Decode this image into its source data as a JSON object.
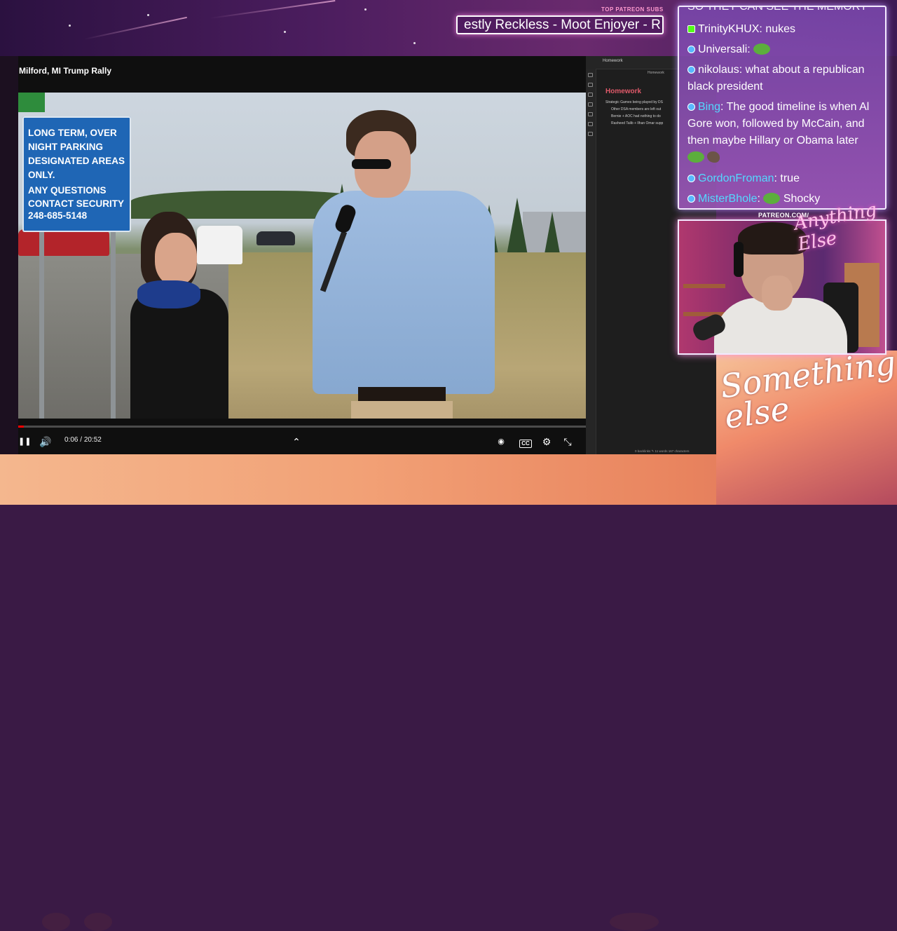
{
  "ticker": {
    "label": "TOP PATREON SUBS",
    "text": "estly Reckless - Moot Enjoyer - R"
  },
  "video": {
    "title": "Milford, MI Trump Rally",
    "sign": {
      "line1": "LONG TERM, OVER NIGHT PARKING DESIGNATED AREAS ONLY.",
      "line2": "ANY QUESTIONS CONTACT SECURITY",
      "phone": "248-685-5148"
    },
    "time_current": "0:06",
    "time_total": "20:52",
    "progress": 0.005,
    "progress_color": "#ff0000",
    "actions": [
      "like-icon",
      "dislike-icon",
      "comment-icon",
      "chat-icon",
      "share-icon",
      "sparkle-icon",
      "more-icon"
    ],
    "controls": {
      "play_pause_glyph": "❚❚",
      "volume_glyph": "🔊",
      "expand_glyph": "⌃",
      "pip_glyph": "◉",
      "cc_glyph": "CC",
      "settings_glyph": "⚙",
      "fullscreen_exit_glyph": "⤡",
      "separator": "/"
    }
  },
  "notes": {
    "tab": "Homework",
    "breadcrumb": "Homework",
    "title": "Homework",
    "lines": [
      "Strategic Games being played by DS",
      "Other DSA members are left out",
      "Bernie + AOC had nothing to do",
      "Rasheed Talib + Ilhan Omar supp"
    ],
    "status": "0 backlinks  ✎  11 words  167 characters"
  },
  "chat": {
    "cut_text": "SO THEY CAN SEE THE MEMORY",
    "messages": [
      {
        "user": "TrinityKHUX",
        "text": " nukes",
        "badge": "k",
        "user_color": "white"
      },
      {
        "user": "Universali",
        "text": "",
        "badge": "blue",
        "user_color": "white",
        "emote": "frog"
      },
      {
        "user": "nikolaus",
        "text": " what about a republican black president",
        "badge": "blue",
        "user_color": "white"
      },
      {
        "user": "Bing",
        "text": " The good timeline is when Al Gore won, followed by McCain, and then maybe Hillary or Obama later",
        "badge": "blue",
        "user_color": "cyan",
        "emote": "frog+rock"
      },
      {
        "user": "GordonFroman",
        "text": " true",
        "badge": "blue",
        "user_color": "cyan"
      },
      {
        "user": "MisterBhole",
        "text": " Shocky",
        "badge": "blue",
        "user_color": "cyan",
        "emote": "frog"
      }
    ],
    "separator": ":"
  },
  "webcam": {
    "label": "PATREON.COM/",
    "logo": "Anything Else"
  },
  "branding": {
    "script": "Something else"
  },
  "colors": {
    "accent_pink": "#ff9bd0",
    "chat_cyan": "#53d9ff",
    "notes_title": "#e05a6a"
  }
}
